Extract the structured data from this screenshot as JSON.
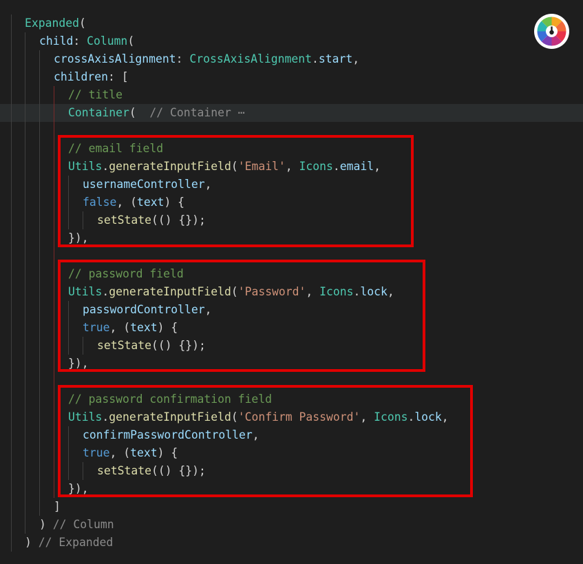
{
  "app_logo_icon": "color-wheel-icon",
  "colors": {
    "background": "#1e1e1e",
    "highlight_line": "#2a2d2e",
    "annotation_box": "#e00000"
  },
  "code_lines": [
    {
      "tokens": [
        {
          "t": "Expanded",
          "c": "cls"
        },
        {
          "t": "(",
          "c": "pun"
        }
      ]
    },
    {
      "tokens": [
        {
          "t": "child",
          "c": "prop"
        },
        {
          "t": ": ",
          "c": "pun"
        },
        {
          "t": "Column",
          "c": "cls"
        },
        {
          "t": "(",
          "c": "pun"
        }
      ]
    },
    {
      "tokens": [
        {
          "t": "crossAxisAlignment",
          "c": "prop"
        },
        {
          "t": ": ",
          "c": "pun"
        },
        {
          "t": "CrossAxisAlignment",
          "c": "cls"
        },
        {
          "t": ".",
          "c": "pun"
        },
        {
          "t": "start",
          "c": "prop"
        },
        {
          "t": ",",
          "c": "pun"
        }
      ]
    },
    {
      "tokens": [
        {
          "t": "children",
          "c": "prop"
        },
        {
          "t": ": [",
          "c": "pun"
        }
      ]
    },
    {
      "tokens": [
        {
          "t": "// title",
          "c": "com"
        }
      ]
    },
    {
      "tokens": [
        {
          "t": "Container",
          "c": "cls"
        },
        {
          "t": "(  ",
          "c": "pun"
        },
        {
          "t": "// Container ⋯",
          "c": "hint"
        }
      ]
    },
    {
      "tokens": []
    },
    {
      "tokens": [
        {
          "t": "// email field",
          "c": "com"
        }
      ]
    },
    {
      "tokens": [
        {
          "t": "Utils",
          "c": "cls"
        },
        {
          "t": ".",
          "c": "pun"
        },
        {
          "t": "generateInputField",
          "c": "fn"
        },
        {
          "t": "(",
          "c": "pun"
        },
        {
          "t": "'Email'",
          "c": "str"
        },
        {
          "t": ", ",
          "c": "pun"
        },
        {
          "t": "Icons",
          "c": "cls"
        },
        {
          "t": ".",
          "c": "pun"
        },
        {
          "t": "email",
          "c": "prop"
        },
        {
          "t": ",",
          "c": "pun"
        }
      ]
    },
    {
      "tokens": [
        {
          "t": "usernameController",
          "c": "prop"
        },
        {
          "t": ",",
          "c": "pun"
        }
      ]
    },
    {
      "tokens": [
        {
          "t": "false",
          "c": "kw"
        },
        {
          "t": ", (",
          "c": "pun"
        },
        {
          "t": "text",
          "c": "prop"
        },
        {
          "t": ") {",
          "c": "pun"
        }
      ]
    },
    {
      "tokens": [
        {
          "t": "setState",
          "c": "fn"
        },
        {
          "t": "(() {});",
          "c": "pun"
        }
      ]
    },
    {
      "tokens": [
        {
          "t": "}),",
          "c": "pun"
        }
      ]
    },
    {
      "tokens": []
    },
    {
      "tokens": [
        {
          "t": "// password field",
          "c": "com"
        }
      ]
    },
    {
      "tokens": [
        {
          "t": "Utils",
          "c": "cls"
        },
        {
          "t": ".",
          "c": "pun"
        },
        {
          "t": "generateInputField",
          "c": "fn"
        },
        {
          "t": "(",
          "c": "pun"
        },
        {
          "t": "'Password'",
          "c": "str"
        },
        {
          "t": ", ",
          "c": "pun"
        },
        {
          "t": "Icons",
          "c": "cls"
        },
        {
          "t": ".",
          "c": "pun"
        },
        {
          "t": "lock",
          "c": "prop"
        },
        {
          "t": ",",
          "c": "pun"
        }
      ]
    },
    {
      "tokens": [
        {
          "t": "passwordController",
          "c": "prop"
        },
        {
          "t": ",",
          "c": "pun"
        }
      ]
    },
    {
      "tokens": [
        {
          "t": "true",
          "c": "kw"
        },
        {
          "t": ", (",
          "c": "pun"
        },
        {
          "t": "text",
          "c": "prop"
        },
        {
          "t": ") {",
          "c": "pun"
        }
      ]
    },
    {
      "tokens": [
        {
          "t": "setState",
          "c": "fn"
        },
        {
          "t": "(() {});",
          "c": "pun"
        }
      ]
    },
    {
      "tokens": [
        {
          "t": "}),",
          "c": "pun"
        }
      ]
    },
    {
      "tokens": []
    },
    {
      "tokens": [
        {
          "t": "// password confirmation field",
          "c": "com"
        }
      ]
    },
    {
      "tokens": [
        {
          "t": "Utils",
          "c": "cls"
        },
        {
          "t": ".",
          "c": "pun"
        },
        {
          "t": "generateInputField",
          "c": "fn"
        },
        {
          "t": "(",
          "c": "pun"
        },
        {
          "t": "'Confirm Password'",
          "c": "str"
        },
        {
          "t": ", ",
          "c": "pun"
        },
        {
          "t": "Icons",
          "c": "cls"
        },
        {
          "t": ".",
          "c": "pun"
        },
        {
          "t": "lock",
          "c": "prop"
        },
        {
          "t": ",",
          "c": "pun"
        }
      ]
    },
    {
      "tokens": [
        {
          "t": "confirmPasswordController",
          "c": "prop"
        },
        {
          "t": ",",
          "c": "pun"
        }
      ]
    },
    {
      "tokens": [
        {
          "t": "true",
          "c": "kw"
        },
        {
          "t": ", (",
          "c": "pun"
        },
        {
          "t": "text",
          "c": "prop"
        },
        {
          "t": ") {",
          "c": "pun"
        }
      ]
    },
    {
      "tokens": [
        {
          "t": "setState",
          "c": "fn"
        },
        {
          "t": "(() {});",
          "c": "pun"
        }
      ]
    },
    {
      "tokens": [
        {
          "t": "}),",
          "c": "pun"
        }
      ]
    },
    {
      "tokens": [
        {
          "t": "]",
          "c": "pun"
        }
      ]
    },
    {
      "tokens": [
        {
          "t": ") ",
          "c": "pun"
        },
        {
          "t": "// Column",
          "c": "hint"
        }
      ]
    },
    {
      "tokens": [
        {
          "t": ") ",
          "c": "pun"
        },
        {
          "t": "// Expanded",
          "c": "hint"
        }
      ]
    }
  ]
}
